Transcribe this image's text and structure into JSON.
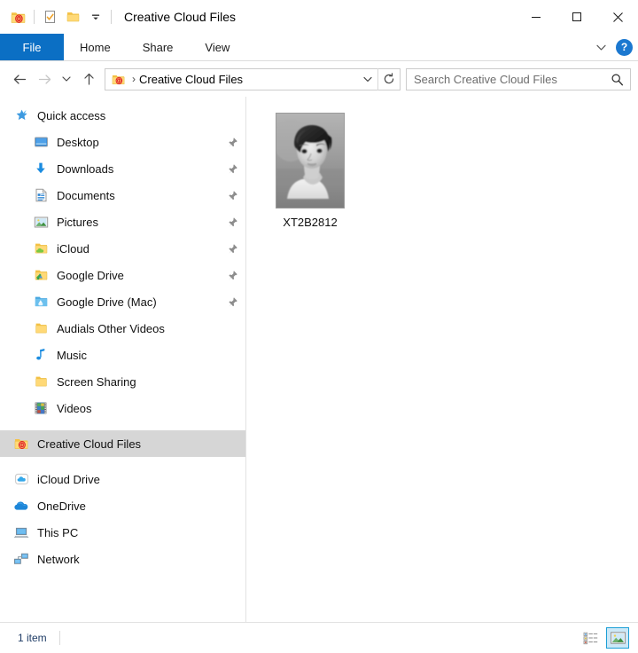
{
  "window": {
    "title": "Creative Cloud Files",
    "quick_access_toolbar": [
      {
        "name": "creative-cloud-folder-icon",
        "label": "Creative Cloud Files"
      },
      {
        "name": "properties-icon",
        "label": "Properties"
      },
      {
        "name": "new-folder-icon",
        "label": "New folder"
      },
      {
        "name": "customize-quick-access-toolbar-icon",
        "label": "Customize Quick Access Toolbar"
      }
    ],
    "controls": {
      "minimize": "—",
      "maximize": "□",
      "close": "✕"
    }
  },
  "ribbon": {
    "tabs": [
      {
        "label": "File",
        "active": true
      },
      {
        "label": "Home",
        "active": false
      },
      {
        "label": "Share",
        "active": false
      },
      {
        "label": "View",
        "active": false
      }
    ],
    "expand_label": "Expand the Ribbon",
    "help_label": "?",
    "accent_color": "#0b6fc4",
    "help_color": "#1b78d0"
  },
  "address_bar": {
    "back_label": "Back",
    "forward_label": "Forward",
    "forward_enabled": false,
    "recent_label": "Recent locations",
    "up_label": "Up to Desktop",
    "breadcrumb": {
      "icon": "creative-cloud-folder-icon",
      "separator": "›",
      "path": "Creative Cloud Files"
    },
    "dropdown_label": "Previous locations",
    "refresh_label": "Refresh"
  },
  "search": {
    "placeholder": "Search Creative Cloud Files",
    "value": "",
    "icon": "search-icon"
  },
  "sidebar": {
    "items": [
      {
        "label": "Quick access",
        "icon": "quick-access-star-icon",
        "level": 0,
        "pinned": false,
        "selected": false
      },
      {
        "label": "Desktop",
        "icon": "desktop-icon",
        "level": 1,
        "pinned": true,
        "selected": false
      },
      {
        "label": "Downloads",
        "icon": "downloads-icon",
        "level": 1,
        "pinned": true,
        "selected": false
      },
      {
        "label": "Documents",
        "icon": "documents-icon",
        "level": 1,
        "pinned": true,
        "selected": false
      },
      {
        "label": "Pictures",
        "icon": "pictures-icon",
        "level": 1,
        "pinned": true,
        "selected": false
      },
      {
        "label": "iCloud",
        "icon": "icloud-folder-icon",
        "level": 1,
        "pinned": true,
        "selected": false
      },
      {
        "label": "Google Drive",
        "icon": "google-drive-icon",
        "level": 1,
        "pinned": true,
        "selected": false
      },
      {
        "label": "Google Drive (Mac)",
        "icon": "google-drive-mac-folder-icon",
        "level": 1,
        "pinned": true,
        "selected": false
      },
      {
        "label": "Audials Other Videos",
        "icon": "folder-icon",
        "level": 1,
        "pinned": false,
        "selected": false
      },
      {
        "label": "Music",
        "icon": "music-note-icon",
        "level": 1,
        "pinned": false,
        "selected": false
      },
      {
        "label": "Screen Sharing",
        "icon": "folder-icon",
        "level": 1,
        "pinned": false,
        "selected": false
      },
      {
        "label": "Videos",
        "icon": "videos-filmstrip-icon",
        "level": 1,
        "pinned": false,
        "selected": false
      },
      {
        "label": "Creative Cloud Files",
        "icon": "creative-cloud-folder-icon",
        "level": 0,
        "pinned": false,
        "selected": true
      },
      {
        "label": "iCloud Drive",
        "icon": "icloud-drive-icon",
        "level": 0,
        "pinned": false,
        "selected": false
      },
      {
        "label": "OneDrive",
        "icon": "onedrive-icon",
        "level": 0,
        "pinned": false,
        "selected": false
      },
      {
        "label": "This PC",
        "icon": "this-pc-icon",
        "level": 0,
        "pinned": false,
        "selected": false
      },
      {
        "label": "Network",
        "icon": "network-icon",
        "level": 0,
        "pinned": false,
        "selected": false
      }
    ],
    "selection_color": "#d6d6d6"
  },
  "content": {
    "files": [
      {
        "name": "XT2B2812",
        "type": "image",
        "thumbnail": "grayscale-portrait-photo"
      }
    ]
  },
  "status_bar": {
    "item_count": "1 item",
    "view_modes": [
      {
        "name": "details-view-button",
        "label": "Details view",
        "active": false
      },
      {
        "name": "large-icons-view-button",
        "label": "Large icons view",
        "active": true
      }
    ],
    "active_color": "#cce8f7",
    "active_border": "#1c9fd6"
  }
}
